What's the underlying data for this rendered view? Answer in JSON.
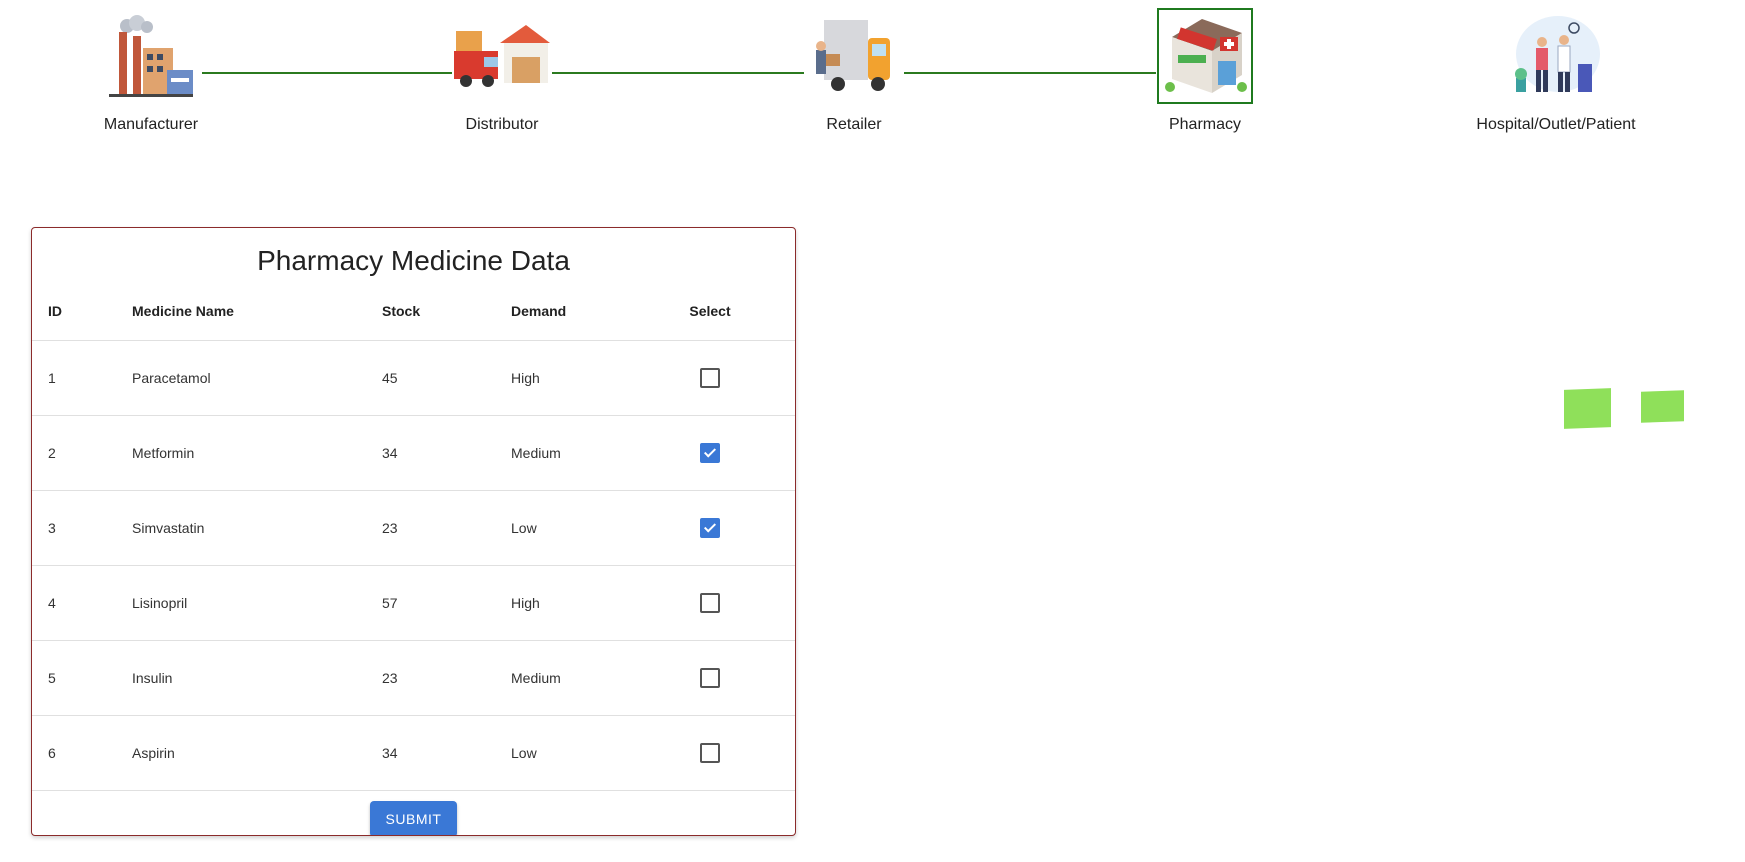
{
  "stages": [
    {
      "label": "Manufacturer",
      "icon": "factory-icon"
    },
    {
      "label": "Distributor",
      "icon": "delivery-truck-warehouse-icon"
    },
    {
      "label": "Retailer",
      "icon": "van-delivery-icon"
    },
    {
      "label": "Pharmacy",
      "icon": "pharmacy-store-icon",
      "active": true
    },
    {
      "label": "Hospital/Outlet/Patient",
      "icon": "doctor-patient-icon"
    }
  ],
  "colors": {
    "chain_line": "#2b7a1f",
    "active_border": "#1f7a1f",
    "accent": "#3a78d6",
    "card_border": "#8b2b2b",
    "green_box": "#8fe05a"
  },
  "table": {
    "title": "Pharmacy Medicine Data",
    "headers": {
      "id": "ID",
      "name": "Medicine Name",
      "stock": "Stock",
      "demand": "Demand",
      "select": "Select"
    },
    "rows": [
      {
        "id": "1",
        "name": "Paracetamol",
        "stock": "45",
        "demand": "High",
        "selected": false
      },
      {
        "id": "2",
        "name": "Metformin",
        "stock": "34",
        "demand": "Medium",
        "selected": true
      },
      {
        "id": "3",
        "name": "Simvastatin",
        "stock": "23",
        "demand": "Low",
        "selected": true
      },
      {
        "id": "4",
        "name": "Lisinopril",
        "stock": "57",
        "demand": "High",
        "selected": false
      },
      {
        "id": "5",
        "name": "Insulin",
        "stock": "23",
        "demand": "Medium",
        "selected": false
      },
      {
        "id": "6",
        "name": "Aspirin",
        "stock": "34",
        "demand": "Low",
        "selected": false
      }
    ],
    "submit_label": "SUBMIT"
  }
}
